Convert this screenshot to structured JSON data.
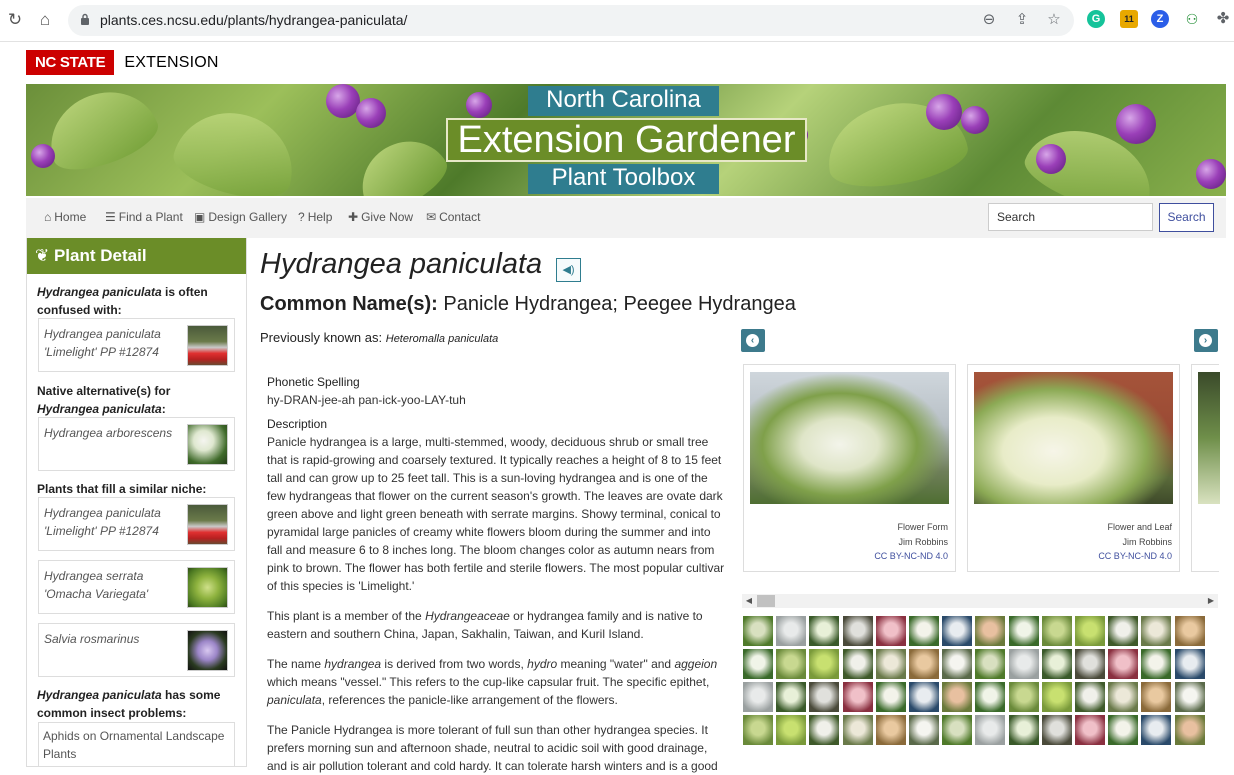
{
  "browser": {
    "url": "plants.ces.ncsu.edu/plants/hydrangea-paniculata/",
    "extensions": [
      "grammarly-icon",
      "calendar-icon",
      "zotero-icon",
      "extension-icon",
      "puzzle-icon"
    ],
    "calendar_badge": "11"
  },
  "site": {
    "brand_logo": "NC STATE",
    "brand_extension": "EXTENSION",
    "banner_top": "North Carolina",
    "banner_main": "Extension Gardener",
    "banner_bottom": "Plant Toolbox"
  },
  "nav": {
    "items": [
      {
        "icon": "home-icon",
        "label": "Home"
      },
      {
        "icon": "list-icon",
        "label": "Find a Plant"
      },
      {
        "icon": "image-icon",
        "label": "Design Gallery"
      },
      {
        "icon": "question-icon",
        "label": "Help"
      },
      {
        "icon": "gift-icon",
        "label": "Give Now"
      },
      {
        "icon": "envelope-icon",
        "label": "Contact"
      }
    ],
    "search_placeholder": "Search",
    "search_button": "Search"
  },
  "sidebar": {
    "title": "Plant Detail",
    "confused_intro_bold": "Hydrangea paniculata",
    "confused_intro_rest": " is often confused with:",
    "native_intro": "Native alternative(s) for ",
    "native_intro_bold": "Hydrangea paniculata",
    "native_intro_end": ":",
    "niche_intro": "Plants that fill a similar niche:",
    "insect_intro_bold": "Hydrangea paniculata",
    "insect_intro_rest": " has some common insect problems:",
    "cards": [
      {
        "name": "Hydrangea paniculata 'Limelight' PP #12874"
      },
      {
        "name": "Hydrangea arborescens"
      },
      {
        "name": "Hydrangea paniculata 'Limelight' PP #12874"
      },
      {
        "name": "Hydrangea serrata 'Omacha Variegata'"
      },
      {
        "name": "Salvia rosmarinus"
      }
    ],
    "insect_card": "Aphids on Ornamental Landscape Plants"
  },
  "main": {
    "title": "Hydrangea paniculata",
    "common_label": "Common Name(s):",
    "common_names": "Panicle Hydrangea;  Peegee Hydrangea",
    "prev_label": "Previously known as:",
    "prev_value": "Heteromalla paniculata",
    "phonetic_label": "Phonetic Spelling",
    "phonetic_value": "hy-DRAN-jee-ah pan-ick-yoo-LAY-tuh",
    "description_label": "Description",
    "description": "Panicle hydrangea is a large, multi-stemmed, woody, deciduous shrub or small tree that is rapid-growing and coarsely textured. It typically reaches a height of 8 to 15 feet tall and can grow up to 25 feet tall. This is a sun-loving hydrangea and is one of the few hydrangeas that flower on the current season's growth. The leaves are ovate dark green above and light green beneath with serrate margins. Showy terminal, conical to pyramidal large panicles of creamy white flowers bloom during the summer and into fall and measure 6 to 8 inches long. The bloom changes color as autumn nears from pink to brown. The flower has both fertile and sterile flowers. The most popular cultivar of this species is 'Limelight.'",
    "para2_a": "This plant is a member of the ",
    "para2_i": "Hydrangeaceae",
    "para2_b": " or hydrangea family and is native to eastern and southern China, Japan, Sakhalin, Taiwan, and Kuril Island.",
    "para3_a": "The name ",
    "para3_i1": "hydrangea",
    "para3_b": " is derived from two words, ",
    "para3_i2": "hydro",
    "para3_c": " meaning \"water\" and ",
    "para3_i3": "aggeion",
    "para3_d": " which means \"vessel.\" This refers to the cup-like capsular fruit. The specific epithet, ",
    "para3_i4": "paniculata",
    "para3_e": ", references the panicle-like arrangement of the flowers.",
    "para4": "The Panicle Hydrangea is more tolerant of full sun than other hydrangea species. It prefers morning sun and afternoon shade, neutral to acidic soil with good drainage, and is air pollution tolerant and cold hardy. It can tolerate harsh winters and is a good"
  },
  "gallery": {
    "photos": [
      {
        "caption": "Flower Form",
        "author": "Jim Robbins",
        "license": "CC BY-NC-ND 4.0"
      },
      {
        "caption": "Flower and Leaf",
        "author": "Jim Robbins",
        "license": "CC BY-NC-ND 4.0"
      }
    ],
    "thumb_count": 56
  }
}
